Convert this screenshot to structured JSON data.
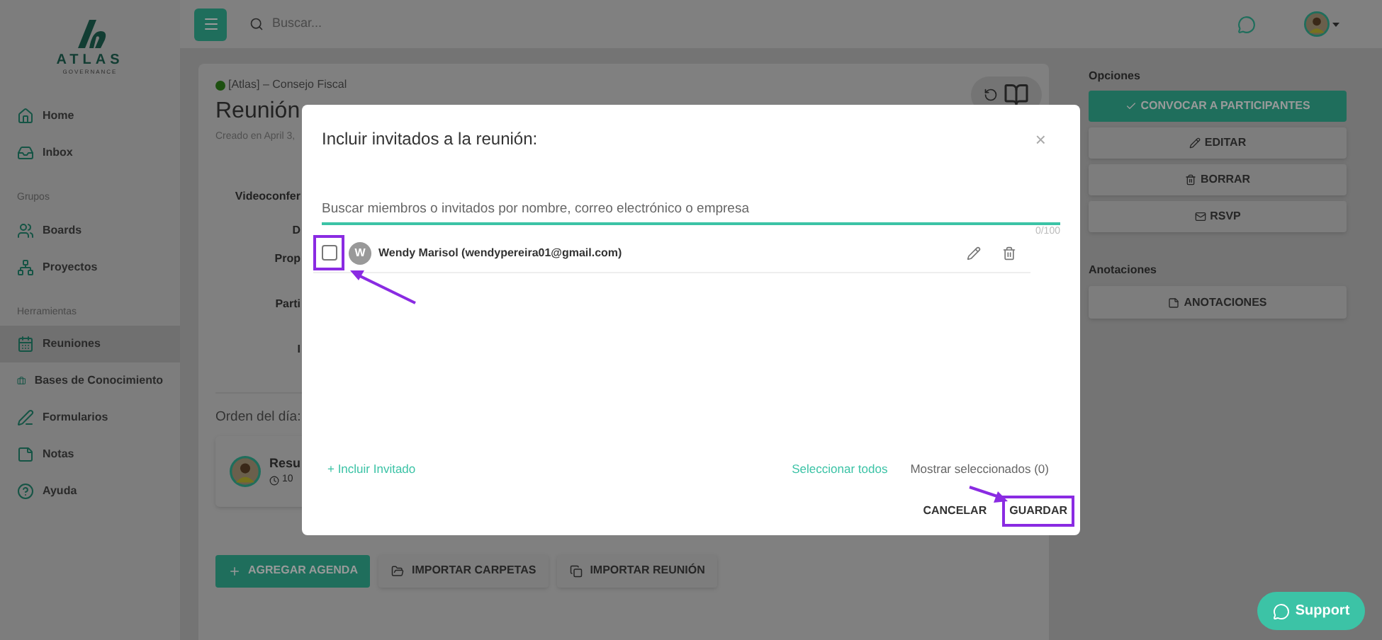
{
  "sidebar": {
    "logo": {
      "name": "ATLAS",
      "tagline": "GOVERNANCE"
    },
    "groups": [
      {
        "items": [
          {
            "label": "Home",
            "selected": false
          },
          {
            "label": "Inbox",
            "selected": false
          }
        ]
      },
      {
        "heading": "Grupos",
        "items": [
          {
            "label": "Boards",
            "selected": false
          },
          {
            "label": "Proyectos",
            "selected": false
          }
        ]
      },
      {
        "heading": "Herramientas",
        "items": [
          {
            "label": "Reuniones",
            "selected": true
          },
          {
            "label": "Bases de Conocimiento",
            "selected": false
          },
          {
            "label": "Formularios",
            "selected": false
          },
          {
            "label": "Notas",
            "selected": false
          },
          {
            "label": "Ayuda",
            "selected": false
          }
        ]
      }
    ]
  },
  "topbar": {
    "search": {
      "placeholder": "Buscar..."
    }
  },
  "meeting": {
    "board": "[Atlas] – Consejo Fiscal",
    "title": "Reunión",
    "created": "Creado en April 3,",
    "field_labels": [
      "Videoconfer",
      "D",
      "Prop",
      "Parti",
      "I"
    ],
    "agenda_heading": "Orden del día:",
    "agenda_item": {
      "title": "Resu",
      "time": "10"
    },
    "buttons": [
      {
        "label": "AGREGAR AGENDA",
        "kind": "primary"
      },
      {
        "label": "IMPORTAR CARPETAS",
        "kind": "secondary"
      },
      {
        "label": "IMPORTAR REUNIÓN",
        "kind": "secondary"
      }
    ]
  },
  "options": {
    "heading": "Opciones",
    "buttons": [
      {
        "label": "CONVOCAR A PARTICIPANTES",
        "kind": "primary"
      },
      {
        "label": "EDITAR",
        "kind": "secondary"
      },
      {
        "label": "BORRAR",
        "kind": "secondary"
      },
      {
        "label": "RSVP",
        "kind": "secondary"
      }
    ]
  },
  "annotations": {
    "heading": "Anotaciones",
    "button": "ANOTACIONES"
  },
  "modal": {
    "title": "Incluir invitados a la reunión:",
    "close": "×",
    "search": {
      "placeholder": "Buscar miembros o invitados por nombre, correo electrónico o empresa"
    },
    "counter": "0/100",
    "members": [
      {
        "initial": "W",
        "name": "Wendy Marisol (wendypereira01@gmail.com)",
        "checked": false
      }
    ],
    "add_link": "+ Incluir Invitado",
    "select_all": "Seleccionar todos",
    "show_selected": "Mostrar seleccionados (0)",
    "actions": [
      {
        "label": "CANCELAR",
        "highlighted": false
      },
      {
        "label": "GUARDAR",
        "highlighted": true
      }
    ]
  },
  "support": "Support"
}
